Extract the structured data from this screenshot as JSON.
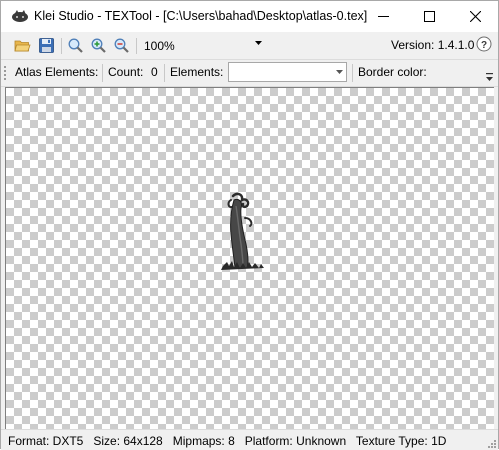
{
  "window": {
    "title": "Klei Studio - TEXTool - [C:\\Users\\bahad\\Desktop\\atlas-0.tex]"
  },
  "toolbar": {
    "zoom_value": "100%",
    "version_label": "Version: 1.4.1.0"
  },
  "atlas_bar": {
    "atlas_elements_label": "Atlas Elements:",
    "count_label": "Count:",
    "count_value": "0",
    "elements_label": "Elements:",
    "elements_selected": "",
    "border_color_label": "Border color:"
  },
  "status": {
    "text": "Format: DXT5   Size: 64x128   Mipmaps: 8   Platform: Unknown   Texture Type: 1D"
  },
  "colors": {
    "checker_dark": "#cccccc",
    "checker_light": "#ffffff",
    "chrome": "#f0f0f0"
  }
}
